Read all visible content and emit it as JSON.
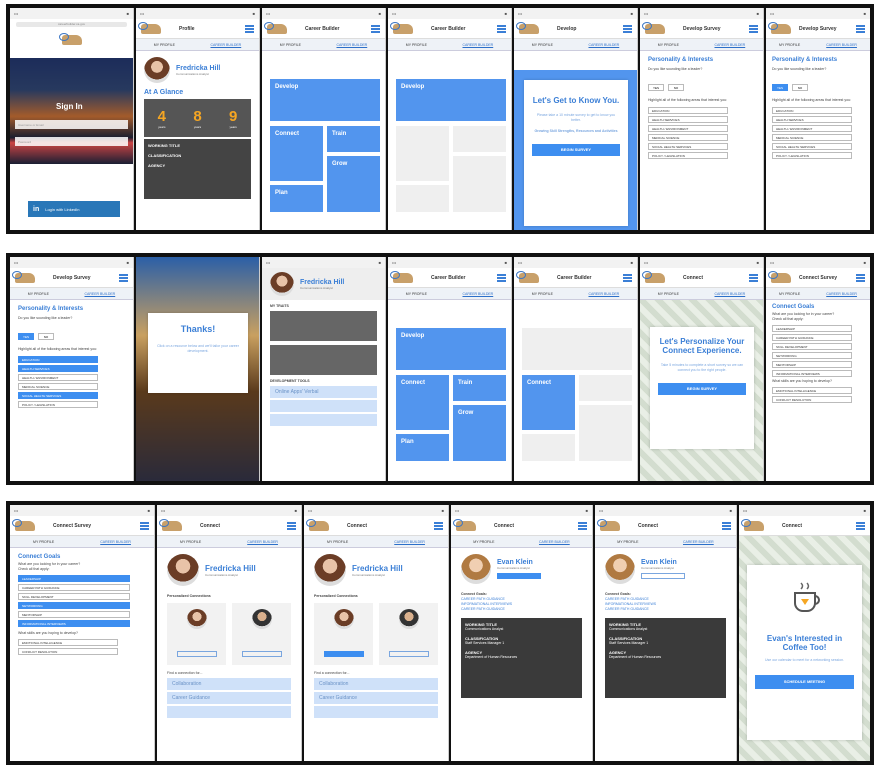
{
  "row1": {
    "frames": [
      {
        "id": "login",
        "url": "careerbuilder.ca.gov",
        "sign_in": "Sign In",
        "user_placeholder": "Username or Email",
        "pass_placeholder": "Password",
        "linkedin_label": "Login with LinkedIn"
      },
      {
        "id": "profile",
        "title": "Profile",
        "tab_my": "MY PROFILE",
        "tab_cb": "CAREER BUILDER",
        "name": "Fredricka Hill",
        "subtitle": "Communications Analyst",
        "glance_title": "At A Glance",
        "stats": [
          {
            "num": "4",
            "label": "years"
          },
          {
            "num": "8",
            "label": "years"
          },
          {
            "num": "9",
            "label": "years"
          }
        ],
        "info": [
          "WORKING TITLE",
          "CLASSIFICATION",
          "AGENCY"
        ]
      },
      {
        "id": "cb1",
        "title": "Career Builder",
        "tiles": [
          "Develop",
          "Connect",
          "Train",
          "Grow",
          "Plan"
        ]
      },
      {
        "id": "cb2",
        "title": "Career Builder",
        "tiles": [
          "Develop"
        ]
      },
      {
        "id": "develop",
        "title": "Develop",
        "headline": "Let's Get to Know You.",
        "body": "Please take a 10 minute survey to get to know you better.",
        "body2": "Growing Skill Strengths, Resources and Activities",
        "button": "BEGIN SURVEY"
      },
      {
        "id": "survey1",
        "title": "Develop Survey",
        "section": "Personality & Interests",
        "question": "Do you like sounding like a leader?",
        "yes": "YES",
        "no": "NO",
        "question2": "Highlight all of the following areas that interest you:",
        "options": [
          "EDUCATION",
          "HEALTH SERVICES",
          "HEALTH / ENVIRONMENT",
          "MEDICAL SCIENCE",
          "SOCIAL HEALTH SERVICES",
          "POLICY / LEGISLATION"
        ]
      },
      {
        "id": "survey2",
        "title": "Develop Survey",
        "section": "Personality & Interests",
        "question": "Do you like sounding like a leader?",
        "yes": "YES",
        "no": "NO",
        "question2": "Highlight all of the following areas that interest you:",
        "options": [
          "EDUCATION",
          "HEALTH SERVICES",
          "HEALTH / ENVIRONMENT",
          "MEDICAL SCIENCE",
          "SOCIAL HEALTH SERVICES",
          "POLICY / LEGISLATION"
        ]
      }
    ]
  },
  "row2": {
    "frames": [
      {
        "id": "survey3",
        "title": "Develop Survey",
        "section": "Personality & Interests",
        "question": "Do you like sounding like a leader?",
        "yes": "YES",
        "no": "NO",
        "question2": "Highlight all of the following areas that interest you:",
        "options": [
          "EDUCATION",
          "HEALTH SERVICES",
          "HEALTH / ENVIRONMENT",
          "MEDICAL SCIENCE",
          "SOCIAL HEALTH SERVICES",
          "POLICY / LEGISLATION"
        ]
      },
      {
        "id": "thanks",
        "title": "Develop Survey",
        "headline": "Thanks!",
        "body": "Click on a resource below and we'll tailor your career development."
      },
      {
        "id": "develop2",
        "title": "Develop",
        "name": "Fredricka Hill",
        "subtitle": "Communications Analyst",
        "section1": "MY TRAITS",
        "section2": "DEVELOPMENT TOOLS",
        "lbar": "Online Apps' Verbal"
      },
      {
        "id": "cb3",
        "title": "Career Builder",
        "tiles": [
          "Develop",
          "Connect",
          "Train",
          "Grow",
          "Plan"
        ]
      },
      {
        "id": "cb4",
        "title": "Career Builder",
        "tiles": [
          "Connect"
        ]
      },
      {
        "id": "connect1",
        "title": "Connect",
        "headline": "Let's Personalize Your Connect Experience.",
        "body": "Take 5 minutes to complete a short survey so we can connect you to the right people.",
        "button": "BEGIN SURVEY"
      },
      {
        "id": "connect2",
        "title": "Connect Survey",
        "section": "Connect Goals",
        "question": "What are you looking for in your career?",
        "question2": "Check all that apply:",
        "options": [
          "LEADERSHIP",
          "CAREER PATH GUIDANCE",
          "SKILL DEVELOPMENT",
          "NETWORKING",
          "MENTORSHIP",
          "INFORMATIONAL INTERVIEWS"
        ],
        "question3": "What skills are you hoping to develop?",
        "options2": [
          "EMOTIONAL INTELLIGENCE",
          "CONFLICT RESOLUTION"
        ]
      }
    ]
  },
  "row3": {
    "frames": [
      {
        "id": "connect3",
        "title": "Connect Survey",
        "section": "Connect Goals",
        "question": "What are you looking for in your career?",
        "question2": "Check all that apply:",
        "options": [
          "LEADERSHIP",
          "CAREER PATH GUIDANCE",
          "SKILL DEVELOPMENT",
          "NETWORKING",
          "MENTORSHIP",
          "INFORMATIONAL INTERVIEWS"
        ],
        "selected": [
          0,
          3,
          5
        ],
        "question3": "What skills are you hoping to develop?",
        "options2": [
          "EMOTIONAL INTELLIGENCE",
          "CONFLICT RESOLUTION"
        ]
      },
      {
        "id": "connect4",
        "title": "Connect",
        "tab_my": "MY PROFILE",
        "tab_cb": "CAREER BUILDER",
        "name": "Fredricka Hill",
        "subtitle": "Communications Analyst",
        "section": "Personalized Connections",
        "find": "Find a connection for...",
        "bars": [
          "Collaboration",
          "Career Guidance"
        ]
      },
      {
        "id": "connect5",
        "title": "Connect",
        "name": "Fredricka Hill",
        "subtitle": "Communications Analyst",
        "section": "Personalized Connections",
        "find": "Find a connection for...",
        "bars": [
          "Collaboration",
          "Career Guidance"
        ]
      },
      {
        "id": "connect6",
        "title": "Connect",
        "name": "Evan Klein",
        "subtitle": "Communications Analyst",
        "goals": "Connect Goals:",
        "goal_items": [
          "CAREER PATH GUIDANCE",
          "INFORMATIONAL INTERVIEWS",
          "CAREER PATH GUIDANCE"
        ],
        "info": [
          {
            "k": "WORKING TITLE",
            "v": "Communications Analyst"
          },
          {
            "k": "CLASSIFICATION",
            "v": "Staff Services Manager 1"
          },
          {
            "k": "AGENCY",
            "v": "Department of Human Resources"
          }
        ]
      },
      {
        "id": "connect7",
        "title": "Connect",
        "name": "Evan Klein",
        "subtitle": "Communications Analyst",
        "goals": "Connect Goals:",
        "goal_items": [
          "CAREER PATH GUIDANCE",
          "INFORMATIONAL INTERVIEWS",
          "CAREER PATH GUIDANCE"
        ],
        "info": [
          {
            "k": "WORKING TITLE",
            "v": "Communications Analyst"
          },
          {
            "k": "CLASSIFICATION",
            "v": "Staff Services Manager 1"
          },
          {
            "k": "AGENCY",
            "v": "Department of Human Resources"
          }
        ]
      },
      {
        "id": "coffee",
        "title": "Connect",
        "headline": "Evan's Interested in Coffee Too!",
        "body": "Use our calendar to meet for a networking session.",
        "button": "SCHEDULE MEETING"
      }
    ]
  },
  "shared": {
    "tab_my": "MY PROFILE",
    "tab_cb": "CAREER BUILDER"
  }
}
